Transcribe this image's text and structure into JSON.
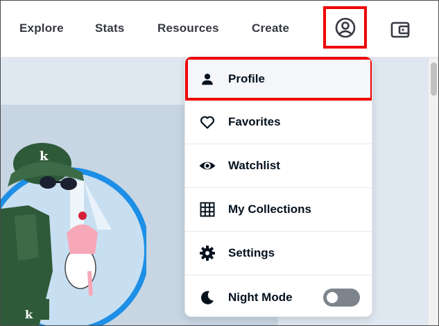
{
  "nav": {
    "links": [
      "Explore",
      "Stats",
      "Resources",
      "Create"
    ],
    "account_icon": "user-circle-icon",
    "wallet_icon": "wallet-icon"
  },
  "menu": {
    "items": [
      {
        "label": "Profile",
        "icon": "person-icon"
      },
      {
        "label": "Favorites",
        "icon": "heart-icon"
      },
      {
        "label": "Watchlist",
        "icon": "eye-icon"
      },
      {
        "label": "My Collections",
        "icon": "grid-icon"
      },
      {
        "label": "Settings",
        "icon": "gear-icon"
      },
      {
        "label": "Night Mode",
        "icon": "moon-icon"
      }
    ],
    "night_mode_enabled": false
  },
  "colors": {
    "highlight": "#ef0000",
    "text": "#353840",
    "menu_text": "#04111d",
    "toggle_off": "#7d848c"
  }
}
